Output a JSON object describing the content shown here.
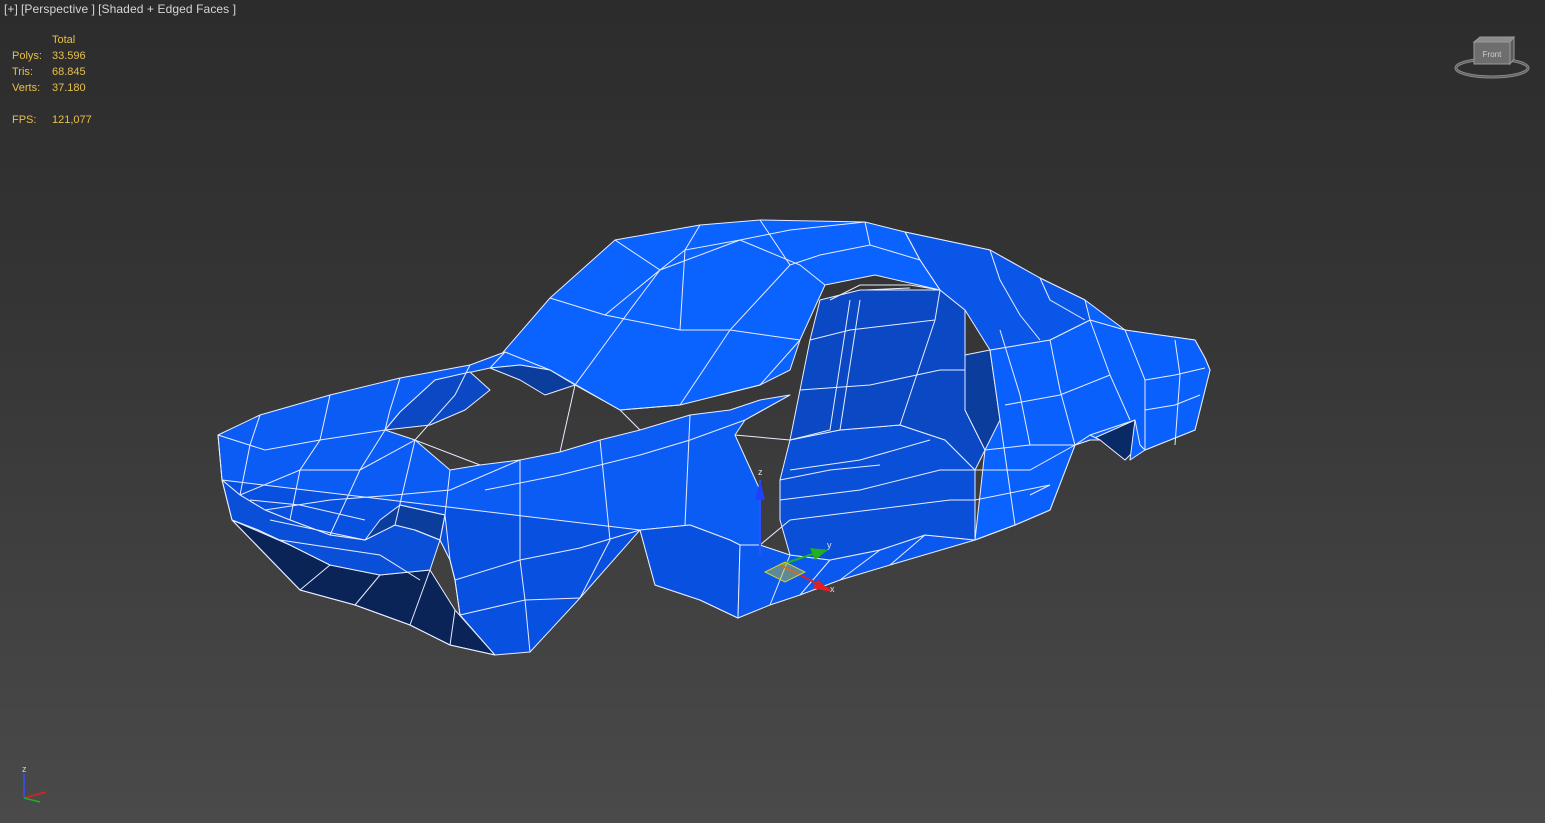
{
  "viewport": {
    "menu_plus": "[+]",
    "view_name": "[Perspective ]",
    "shading_mode": "[Shaded + Edged Faces ]"
  },
  "stats": {
    "header": "Total",
    "polys_label": "Polys:",
    "polys_value": "33.596",
    "tris_label": "Tris:",
    "tris_value": "68.845",
    "verts_label": "Verts:",
    "verts_value": "37.180",
    "fps_label": "FPS:",
    "fps_value": "121,077"
  },
  "viewcube": {
    "face_label": "Front"
  },
  "gizmo": {
    "x_label": "x",
    "y_label": "y",
    "z_label": "z"
  },
  "tripod": {
    "z_label": "z"
  },
  "colors": {
    "stats_text": "#e6c04a",
    "label_text": "#d6d6d6",
    "mesh_light": "#0a62ff",
    "mesh_mid": "#0850e0",
    "mesh_dark": "#0a3d9c",
    "mesh_shadow": "#0a2458",
    "edge": "#e8ecff",
    "axis_x": "#e02020",
    "axis_y": "#20b020",
    "axis_z": "#3050ff"
  }
}
